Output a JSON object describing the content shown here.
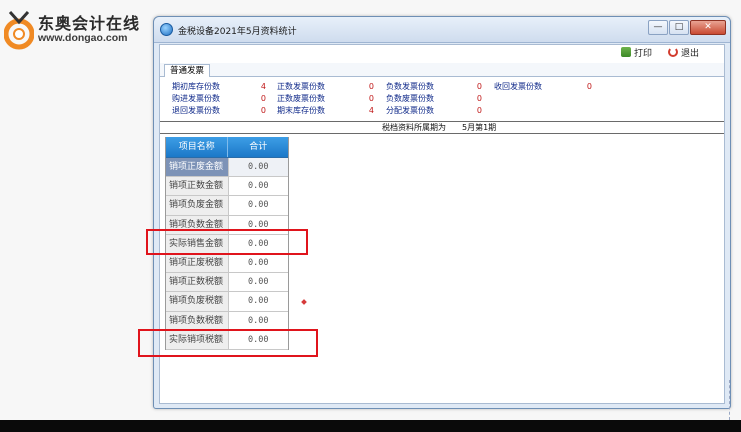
{
  "logo": {
    "name": "东奥会计在线",
    "url": "www.dongao.com"
  },
  "window": {
    "title": "金税设备2021年5月资料统计",
    "controls": {
      "minimize": "—",
      "maximize": "□",
      "close": "✕"
    }
  },
  "toolbar": {
    "print": "打印",
    "exit": "退出"
  },
  "tabs": [
    "普通发票"
  ],
  "stats": [
    {
      "label": "期初库存份数",
      "value": "4"
    },
    {
      "label": "购进发票份数",
      "value": "0"
    },
    {
      "label": "退回发票份数",
      "value": "0"
    },
    {
      "label": "正数发票份数",
      "value": "0"
    },
    {
      "label": "正数废票份数",
      "value": "0"
    },
    {
      "label": "期末库存份数",
      "value": "4"
    },
    {
      "label": "负数发票份数",
      "value": "0"
    },
    {
      "label": "负数废票份数",
      "value": "0"
    },
    {
      "label": "分配发票份数",
      "value": "0"
    },
    {
      "label": "收回发票份数",
      "value": "0"
    }
  ],
  "period": {
    "label": "税档资料所属期为",
    "value": "5月第1期"
  },
  "table": {
    "headers": [
      "项目名称",
      "合计"
    ],
    "rows": [
      {
        "name": "销项正废金额",
        "total": "0.00"
      },
      {
        "name": "销项正数金额",
        "total": "0.00"
      },
      {
        "name": "销项负废金额",
        "total": "0.00"
      },
      {
        "name": "销项负数金额",
        "total": "0.00"
      },
      {
        "name": "实际销售金额",
        "total": "0.00"
      },
      {
        "name": "销项正废税额",
        "total": "0.00"
      },
      {
        "name": "销项正数税额",
        "total": "0.00"
      },
      {
        "name": "销项负废税额",
        "total": "0.00"
      },
      {
        "name": "销项负数税额",
        "total": "0.00"
      },
      {
        "name": "实际销项税额",
        "total": "0.00"
      }
    ]
  },
  "colors": {
    "header_blue": "#1c78c8",
    "label_blue": "#102a8a",
    "value_red": "#c01818",
    "highlight_red": "#e0141c",
    "selected_row": "#7d93b7"
  }
}
